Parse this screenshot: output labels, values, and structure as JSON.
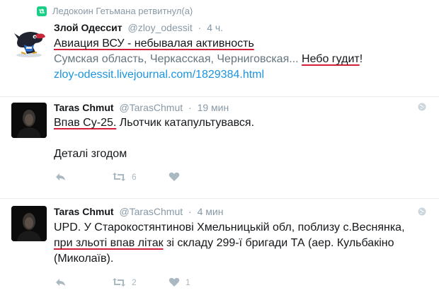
{
  "tweet1": {
    "retweet_label": "Ледокоин Гетьмана ретвитнул(а)",
    "name": "Злой Одессит",
    "handle": "@zloy_odessit",
    "dot": "·",
    "time": "4 ч.",
    "line1": "Авиация ВСУ - небывалая активность",
    "line2_prefix": "Сумская область, Черкасская, Черниговская... ",
    "line2_highlight": "Небо гудит",
    "line2_suffix": "!",
    "link": "zloy-odessit.livejournal.com/1829384.html"
  },
  "tweet2": {
    "name": "Taras Chmut",
    "handle": "@TarasChmut",
    "dot": "·",
    "time": "19 мин",
    "line1_highlight": "Впав Су-25.",
    "line1_rest": " Льотчик катапультувався.",
    "line2": "Деталі згодом",
    "retweet_count": "6"
  },
  "tweet3": {
    "name": "Taras Chmut",
    "handle": "@TarasChmut",
    "dot": "·",
    "time": "4 мин",
    "line1": "UPD. У Старокостянтинові Хмельницькій обл, поблизу с.Веснянка,",
    "line2_highlight": "при зльоті впав літак",
    "line2_rest": " зі складу 299-ї бригади ТА (аер. Кульбакіно",
    "line3": "(Миколаїв).",
    "retweet_count": "2",
    "like_count": "1"
  },
  "colors": {
    "link": "#1b95e0",
    "icon": "#aab8c2",
    "underline": "#d3203a",
    "muted": "#8899a6"
  }
}
